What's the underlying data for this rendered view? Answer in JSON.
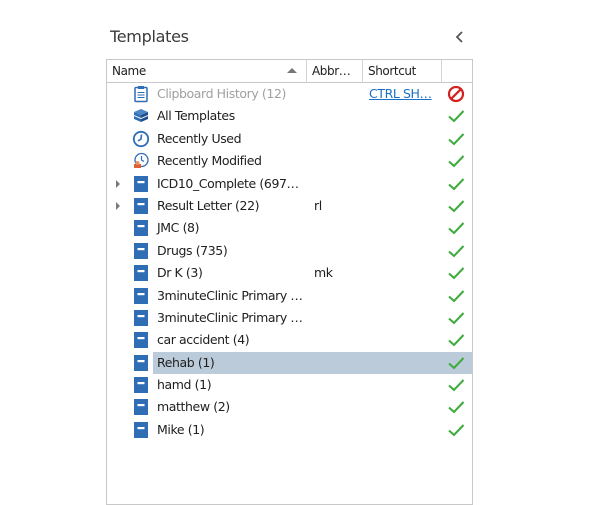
{
  "panel": {
    "title": "Templates",
    "collapse_icon": "chevron-left-icon"
  },
  "columns": {
    "name": "Name",
    "abbr": "Abbr…",
    "shortcut": "Shortcut",
    "status": ""
  },
  "rows": [
    {
      "name": "Clipboard History (12)",
      "icon": "clipboard-icon",
      "abbr": "",
      "shortcut": "CTRL SH…",
      "status": "disabled",
      "dim": true,
      "expandable": false,
      "selected": false
    },
    {
      "name": "All Templates",
      "icon": "books-icon",
      "abbr": "",
      "shortcut": "",
      "status": "enabled",
      "dim": false,
      "expandable": false,
      "selected": false
    },
    {
      "name": "Recently Used",
      "icon": "clock-icon",
      "abbr": "",
      "shortcut": "",
      "status": "enabled",
      "dim": false,
      "expandable": false,
      "selected": false
    },
    {
      "name": "Recently Modified",
      "icon": "clock-edit-icon",
      "abbr": "",
      "shortcut": "",
      "status": "enabled",
      "dim": false,
      "expandable": false,
      "selected": false
    },
    {
      "name": "ICD10_Complete (697…",
      "icon": "folder-template-icon",
      "abbr": "",
      "shortcut": "",
      "status": "enabled",
      "dim": false,
      "expandable": true,
      "selected": false
    },
    {
      "name": "Result Letter (22)",
      "icon": "folder-template-icon",
      "abbr": "rl",
      "shortcut": "",
      "status": "enabled",
      "dim": false,
      "expandable": true,
      "selected": false
    },
    {
      "name": "JMC (8)",
      "icon": "folder-template-icon",
      "abbr": "",
      "shortcut": "",
      "status": "enabled",
      "dim": false,
      "expandable": false,
      "selected": false
    },
    {
      "name": "Drugs (735)",
      "icon": "folder-template-icon",
      "abbr": "",
      "shortcut": "",
      "status": "enabled",
      "dim": false,
      "expandable": false,
      "selected": false
    },
    {
      "name": "Dr K (3)",
      "icon": "folder-template-icon",
      "abbr": "mk",
      "shortcut": "",
      "status": "enabled",
      "dim": false,
      "expandable": false,
      "selected": false
    },
    {
      "name": "3minuteClinic Primary …",
      "icon": "folder-template-icon",
      "abbr": "",
      "shortcut": "",
      "status": "enabled",
      "dim": false,
      "expandable": false,
      "selected": false
    },
    {
      "name": "3minuteClinic Primary …",
      "icon": "folder-template-icon",
      "abbr": "",
      "shortcut": "",
      "status": "enabled",
      "dim": false,
      "expandable": false,
      "selected": false
    },
    {
      "name": "car accident (4)",
      "icon": "folder-template-icon",
      "abbr": "",
      "shortcut": "",
      "status": "enabled",
      "dim": false,
      "expandable": false,
      "selected": false
    },
    {
      "name": "Rehab (1)",
      "icon": "folder-template-icon",
      "abbr": "",
      "shortcut": "",
      "status": "enabled",
      "dim": false,
      "expandable": false,
      "selected": true
    },
    {
      "name": "hamd (1)",
      "icon": "folder-template-icon",
      "abbr": "",
      "shortcut": "",
      "status": "enabled",
      "dim": false,
      "expandable": false,
      "selected": false
    },
    {
      "name": "matthew (2)",
      "icon": "folder-template-icon",
      "abbr": "",
      "shortcut": "",
      "status": "enabled",
      "dim": false,
      "expandable": false,
      "selected": false
    },
    {
      "name": "Mike (1)",
      "icon": "folder-template-icon",
      "abbr": "",
      "shortcut": "",
      "status": "enabled",
      "dim": false,
      "expandable": false,
      "selected": false
    }
  ],
  "colors": {
    "selection": "#bccbd9",
    "check": "#3cab3c",
    "disabled": "#d42020",
    "link": "#1a6fc9",
    "icon_blue": "#2f6db5"
  }
}
